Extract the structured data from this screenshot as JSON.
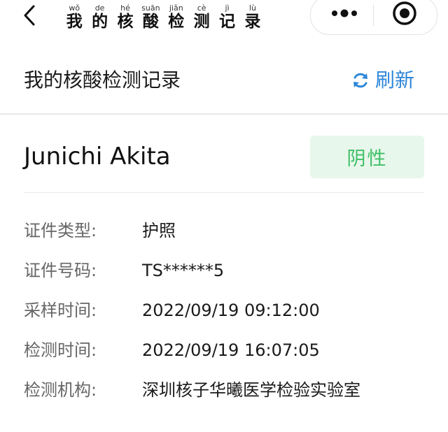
{
  "nav": {
    "title_chars": [
      {
        "pinyin": "wǒ",
        "char": "我"
      },
      {
        "pinyin": "de",
        "char": "的"
      },
      {
        "pinyin": "hé",
        "char": "核"
      },
      {
        "pinyin": "suān",
        "char": "酸"
      },
      {
        "pinyin": "jiǎn",
        "char": "检"
      },
      {
        "pinyin": "cè",
        "char": "测"
      },
      {
        "pinyin": "jì",
        "char": "记"
      },
      {
        "pinyin": "lù",
        "char": "录"
      }
    ],
    "back_icon": "chevron-left-icon",
    "more_icon": "more-dots-icon",
    "close_icon": "target-close-icon"
  },
  "header": {
    "title": "我的核酸检测记录",
    "refresh_label": "刷新",
    "refresh_icon": "refresh-icon",
    "accent_color": "#2d86d9"
  },
  "record": {
    "name": "Junichi Akita",
    "result": "阴性",
    "result_color": "#3fbf66",
    "result_bg": "#e8f7ec",
    "fields": [
      {
        "label": "证件类型:",
        "value": "护照"
      },
      {
        "label": "证件号码:",
        "value": "TS******5"
      },
      {
        "label": "采样时间:",
        "value": "2022/09/19 09:12:00"
      },
      {
        "label": "检测时间:",
        "value": "2022/09/19 16:07:05"
      },
      {
        "label": "检测机构:",
        "value": "深圳核子华曦医学检验实验室"
      }
    ]
  }
}
